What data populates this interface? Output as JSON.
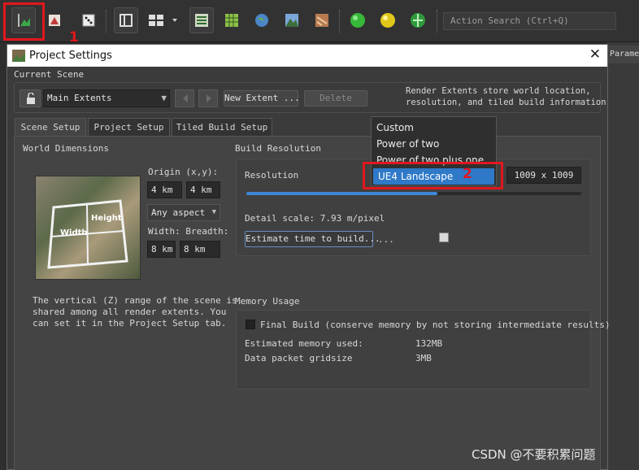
{
  "toolbar": {
    "icons": [
      "landscape-edit-icon",
      "terrain-paint-icon",
      "dice-icon",
      "panel-layout-icon",
      "grid-layout-icon",
      "layer-view-icon",
      "grid-map-icon",
      "globe-icon",
      "mountain-icon",
      "texture-icon",
      "green-sphere-icon",
      "yellow-sphere-icon",
      "green-globe-icon"
    ],
    "action_search_placeholder": "Action Search (Ctrl+Q)",
    "right_tab_label": "Paramet"
  },
  "annotations": {
    "marker_1": "1",
    "marker_2": "2"
  },
  "dialog": {
    "title": "Project Settings",
    "close_glyph": "✕",
    "current_scene_label": "Current Scene",
    "extent_select_value": "Main Extents",
    "new_extent_button": "New Extent ...",
    "delete_button": "Delete",
    "info_text_line1": "Render Extents store world location,",
    "info_text_line2": "resolution, and tiled build information",
    "tabs": [
      {
        "label": "Scene Setup",
        "active": true
      },
      {
        "label": "Project Setup",
        "active": false
      },
      {
        "label": "Tiled Build Setup",
        "active": false
      }
    ],
    "world": {
      "group_label": "World Dimensions",
      "origin_label": "Origin (x,y):",
      "origin_x": "4 km",
      "origin_y": "4 km",
      "aspect_value": "Any aspect",
      "size_label": "Width: Breadth:",
      "width": "8 km",
      "breadth": "8 km",
      "preview_height_label": "Height",
      "preview_width_label": "Width",
      "note_line1": "The vertical (Z) range of the scene is",
      "note_line2": "shared among all render extents. You",
      "note_line3": "can set it in the Project Setup tab."
    },
    "build_resolution": {
      "group_label": "Build Resolution",
      "resolution_label": "Resolution",
      "resolution_value": "1009 x 1009",
      "slider_fraction": 0.57,
      "detail_scale": "Detail scale: 7.93 m/pixel",
      "estimate_button": "Estimate time to build...",
      "estimate_result": "..."
    },
    "resolution_dropdown": {
      "options": [
        "Custom",
        "Power of two",
        "Power of two plus one",
        "UE4 Landscape"
      ],
      "selected": "UE4 Landscape"
    },
    "memory": {
      "group_label": "Memory Usage",
      "final_build_label": "Final Build (conserve memory by not storing intermediate results)",
      "final_build_checked": false,
      "estimated_label": "Estimated memory used:",
      "estimated_value": "132MB",
      "gridsize_label": "Data packet gridsize",
      "gridsize_value": "3MB"
    }
  },
  "watermark": "CSDN @不要积累问题",
  "colors": {
    "accent_blue": "#2f79c8",
    "annotation_red": "#e0171e"
  }
}
